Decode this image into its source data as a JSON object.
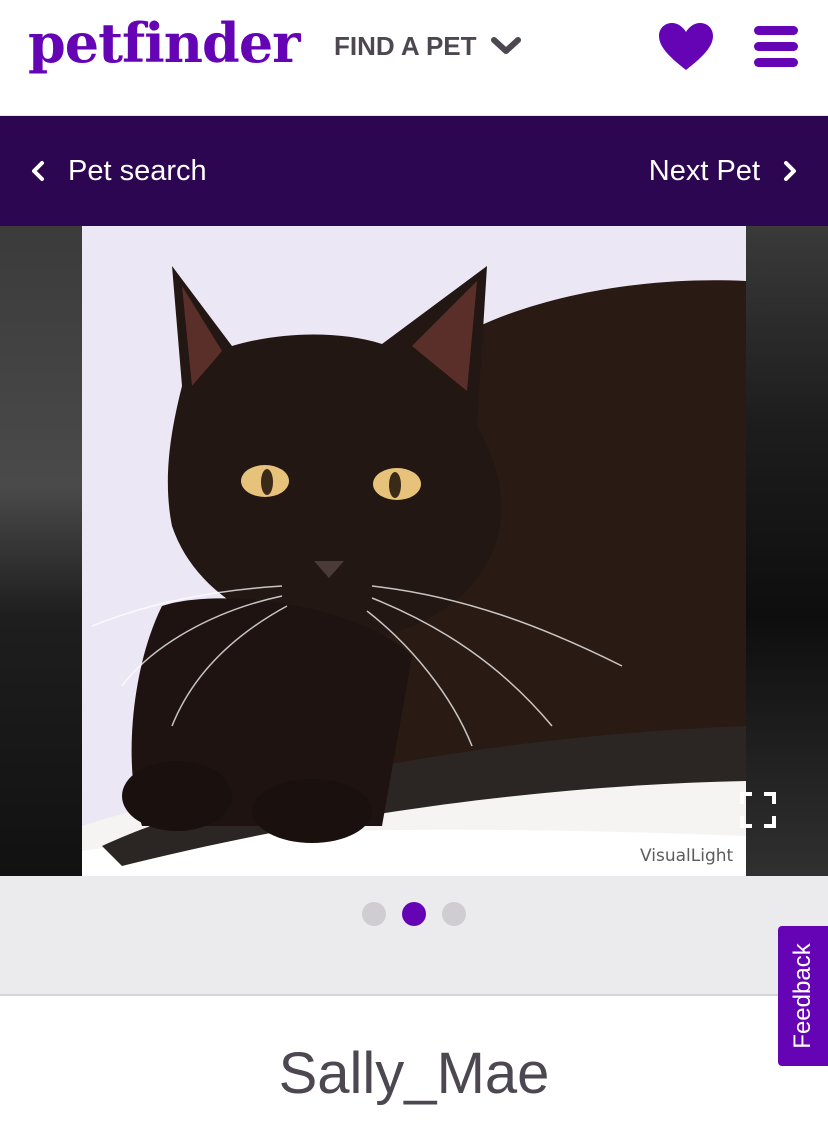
{
  "header": {
    "logo_text": "petfinder",
    "find_pet_label": "FIND A PET",
    "favorites_icon": "heart-icon",
    "menu_icon": "hamburger-menu-icon"
  },
  "nav": {
    "back_label": "Pet search",
    "next_label": "Next Pet"
  },
  "carousel": {
    "watermark": "VisualLight",
    "expand_icon": "fullscreen-icon",
    "total_slides": 3,
    "active_slide": 2
  },
  "pet": {
    "name": "Sally_Mae"
  },
  "feedback": {
    "label": "Feedback"
  },
  "colors": {
    "brand_purple": "#6504b5",
    "nav_bg": "#2c0651",
    "text_gray": "#4d4751"
  }
}
